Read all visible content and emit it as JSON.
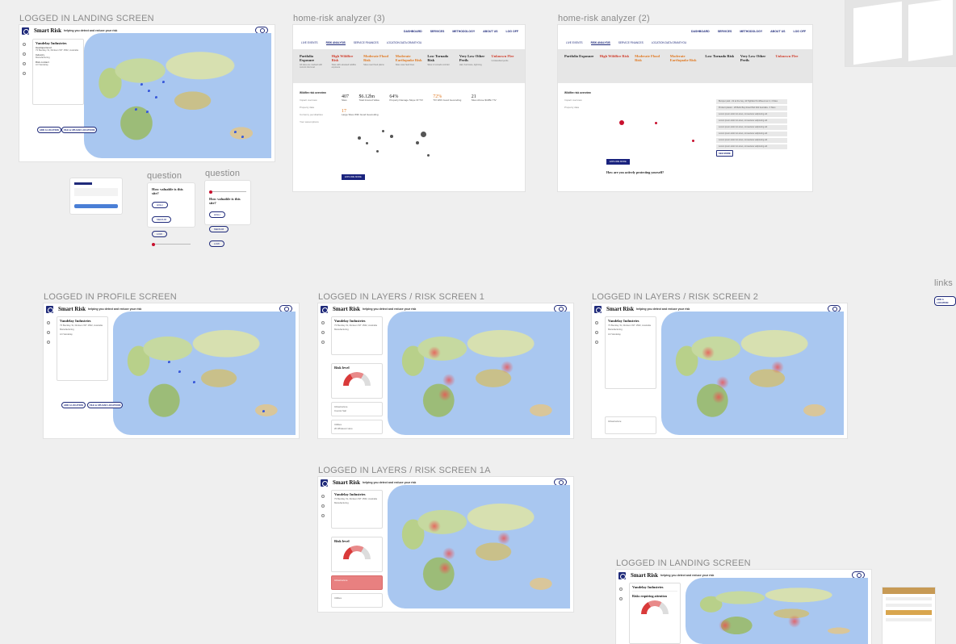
{
  "labels": {
    "landing1": "LOGGED IN  LANDING SCREEN",
    "analyzer3": "home-risk analyzer (3)",
    "analyzer2": "home-risk analyzer (2)",
    "question1": "question",
    "question2": "question",
    "profile": "LOGGED IN PROFILE SCREEN",
    "layers1": "LOGGED IN  LAYERS / RISK SCREEN 1",
    "layers2": "LOGGED IN  LAYERS / RISK SCREEN 2",
    "layers1a": "LOGGED IN  LAYERS / RISK SCREEN 1A",
    "landing2": "LOGGED IN  LANDING SCREEN",
    "links": "links"
  },
  "app": {
    "title": "Smart Risk",
    "tagline": "helping you detect and reduce your risk",
    "company": "Vandelay Industries",
    "hq_label": "Headquartered",
    "hq_value": "73 Beckley St, Dickson WT 1562, Australia",
    "industry_label": "Industry",
    "industry_value": "Manufacturing",
    "contact_label": "Risk contact",
    "contact_value": "Art Vandelay",
    "risk_level": "Risk level",
    "infrastructure": "Infrastructure",
    "infra_sub": "Cosmic Sail",
    "infra_sub2": "20 Whatever Here",
    "utilities": "Utilities",
    "risks_attention": "Risks requiring attention",
    "add_location": "ADD A LOCATION",
    "file_upload": "FILE & UPLOAD LOCATIONS"
  },
  "analyzer": {
    "nav": [
      "DASHBOARD",
      "SERVICES",
      "METHODOLOGY",
      "ABOUT US",
      "LOG OFF"
    ],
    "tabs": [
      "LIVE EVENTS",
      "RISK ANALYSIS",
      "SERVICE FINANCES",
      "LOCATION DATA GRAVEYOU"
    ],
    "cards": [
      {
        "title": "Portfolio Exposure",
        "desc": "All sites are marked with current risk level",
        "cls": ""
      },
      {
        "title": "High Wildfire Risk",
        "desc": "Sites with elevated wildfire exposure",
        "cls": "red"
      },
      {
        "title": "Moderate Flood Risk",
        "desc": "Sites near flood plains",
        "cls": "or"
      },
      {
        "title": "Moderate Earthquake Risk",
        "desc": "Sites near fault lines",
        "cls": "or"
      },
      {
        "title": "Low Tornado Risk",
        "desc": "Sites in tornado corridor",
        "cls": ""
      },
      {
        "title": "Very Low Other Perils",
        "desc": "Hail, hurricane, lightning",
        "cls": ""
      },
      {
        "title": "Unknown Flee",
        "desc": "Unclassified perils",
        "cls": "red"
      }
    ],
    "side": [
      "Wildfire risk overview",
      "Impact overview",
      "Property data",
      "Currency peculiarities",
      "Your assumptions"
    ],
    "stats": [
      {
        "n": "407",
        "d": "Sites"
      },
      {
        "n": "$6.12bn",
        "d": "Total Insured Value"
      },
      {
        "n": "64%",
        "d": "Property Damage Slope Of TIV"
      },
      {
        "n": "72%",
        "d": "TIV With Good Geocoding"
      },
      {
        "n": "21",
        "d": "Sites Above $10Bn TIV"
      },
      {
        "n": "17",
        "d": "Large Sites With Good Geocoding"
      }
    ],
    "explore": "EXPLORE MORE",
    "question": "How are you actively protecting yourself?",
    "table_rows": [
      "Bumper park - 02 at the bay, 44 Highfield St 4/Reed Loc 2, 4 Sites",
      "Product plaster - 28 Bells Bay Road PE4 D22 Australia - 3 Sites",
      "Lorem ipsum dolor sit amet, consectetur adipiscing elit",
      "Lorem ipsum dolor sit amet, consectetur adipiscing elit",
      "Lorem ipsum dolor sit amet, consectetur adipiscing elit",
      "Lorem ipsum dolor sit amet, consectetur adipiscing elit",
      "Lorem ipsum dolor sit amet, consectetur adipiscing elit",
      "Lorem ipsum dolor sit amet, consectetur adipiscing elit"
    ],
    "see_more": "SEE MORE"
  },
  "questions": {
    "q1": "How valuable is this site?",
    "q2": "How valuable is this site?",
    "options": [
      "HIGH",
      "MEDIUM",
      "LOW"
    ]
  }
}
